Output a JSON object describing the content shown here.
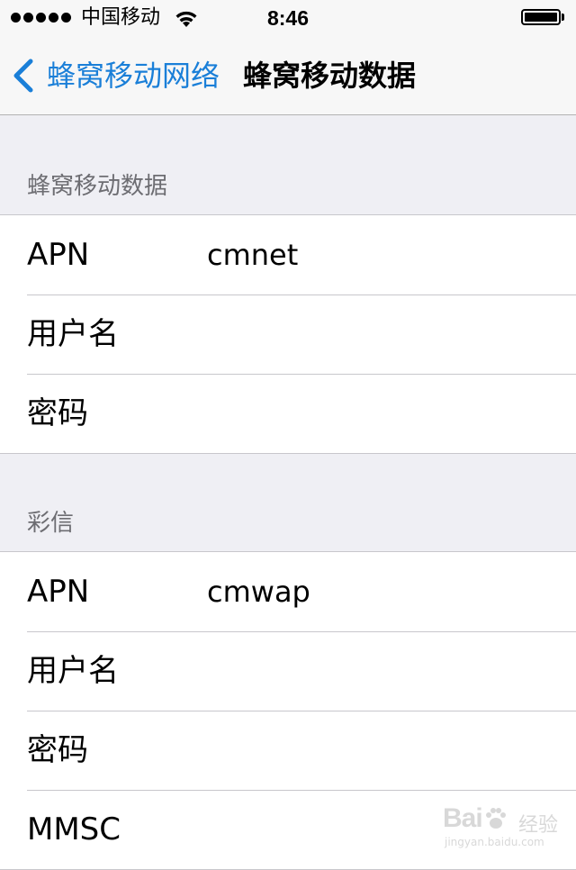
{
  "status_bar": {
    "carrier": "中国移动",
    "time": "8:46",
    "signal_bars": 5,
    "battery_level": 1.0
  },
  "nav": {
    "back_label": "蜂窝移动网络",
    "title": "蜂窝移动数据",
    "accent_color": "#1a7fd8"
  },
  "sections": [
    {
      "header": "蜂窝移动数据",
      "rows": [
        {
          "label": "APN",
          "value": "cmnet"
        },
        {
          "label": "用户名",
          "value": ""
        },
        {
          "label": "密码",
          "value": ""
        }
      ]
    },
    {
      "header": "彩信",
      "rows": [
        {
          "label": "APN",
          "value": "cmwap"
        },
        {
          "label": "用户名",
          "value": ""
        },
        {
          "label": "密码",
          "value": ""
        },
        {
          "label": "MMSC",
          "value": ""
        }
      ]
    }
  ],
  "watermark": {
    "brand": "Bai",
    "suffix": "经验",
    "url": "jingyan.baidu.com"
  }
}
